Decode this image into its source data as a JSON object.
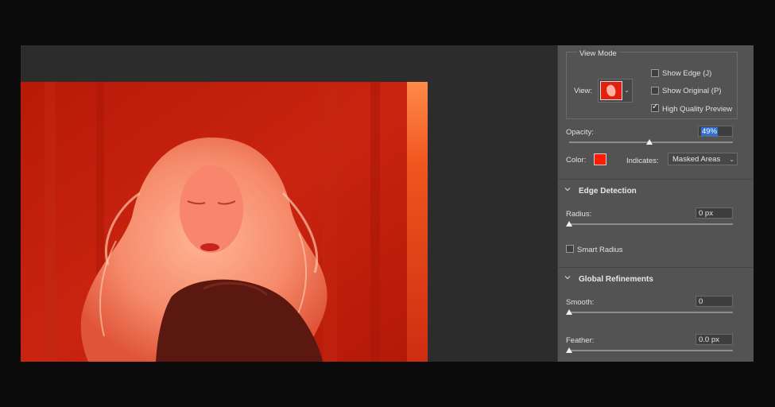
{
  "view_mode": {
    "title": "View Mode",
    "view_label": "View:",
    "show_edge": {
      "label": "Show Edge (J)",
      "checked": false
    },
    "show_original": {
      "label": "Show Original (P)",
      "checked": false
    },
    "high_quality_preview": {
      "label": "High Quality Preview",
      "checked": true
    }
  },
  "opacity": {
    "label": "Opacity:",
    "value_text": "49%",
    "value": 49
  },
  "color": {
    "label": "Color:",
    "swatch": "#ff1a00"
  },
  "indicates": {
    "label": "Indicates:",
    "selected": "Masked Areas"
  },
  "edge_detection": {
    "title": "Edge Detection",
    "radius_label": "Radius:",
    "radius_value": "0 px",
    "radius_level": 0,
    "smart_radius": {
      "label": "Smart Radius",
      "checked": false
    }
  },
  "global_refinements": {
    "title": "Global Refinements",
    "smooth_label": "Smooth:",
    "smooth_value": "0",
    "smooth_level": 0,
    "feather_label": "Feather:",
    "feather_value": "0.0 px",
    "feather_level": 0
  },
  "icons": {
    "chevron": "chevron-down-icon",
    "checkmark": "checkmark-icon",
    "view_thumbnail": "overlay-view-thumbnail"
  },
  "colors": {
    "overlay_red": "#d42a12",
    "panel_bg": "#535353",
    "canvas_bg": "#2c2c2c"
  }
}
